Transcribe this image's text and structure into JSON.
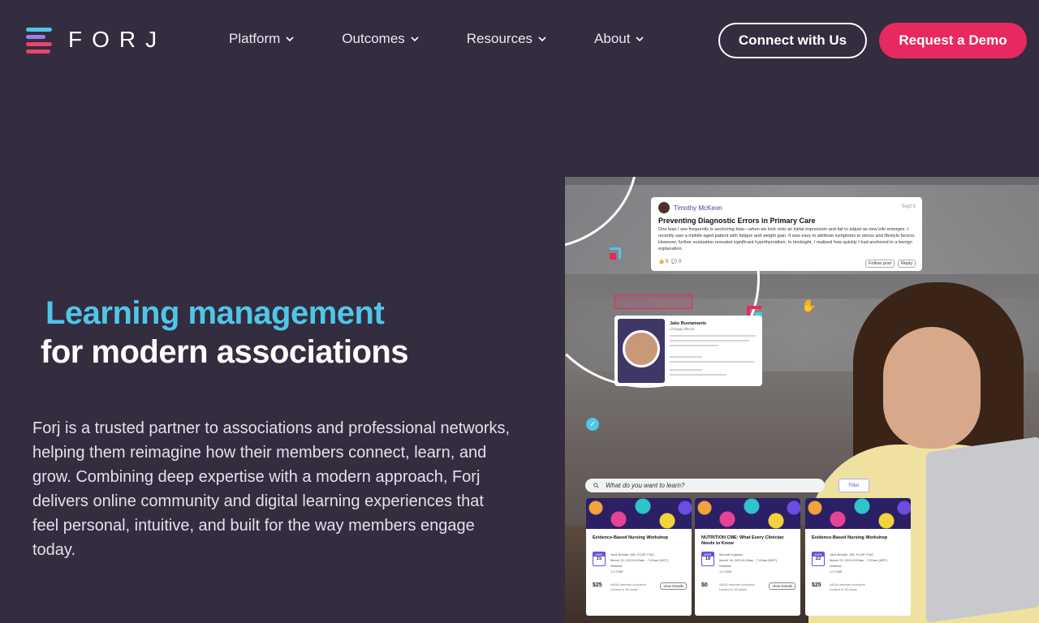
{
  "nav": {
    "logo_text": "FORJ",
    "menu": [
      {
        "label": "Platform"
      },
      {
        "label": "Outcomes"
      },
      {
        "label": "Resources"
      },
      {
        "label": "About"
      }
    ],
    "connect_label": "Connect with Us",
    "demo_label": "Request a Demo"
  },
  "hero": {
    "title_line1": "Learning management",
    "title_line2": "for modern associations",
    "description": "Forj is a trusted partner to associations and professional networks, helping them reimagine how their members connect, learn, and grow. Combining deep expertise with a modern approach, Forj delivers online community and digital learning experiences that feel personal, intuitive, and built for the way members engage today."
  },
  "post": {
    "author": "Timothy McKeon",
    "date": "Sept 5",
    "title": "Preventing Diagnostic Errors in Primary Care",
    "body": "One bias I see frequently is anchoring bias—when we lock onto an initial impression and fail to adjust as new info emerges. I recently saw a middle-aged patient with fatigue and weight gain. It was easy to attribute symptoms to stress and lifestyle factors. However, further evaluation revealed significant hypothyroidism. In hindsight, I realized how quickly I had anchored to a benign explanation.",
    "likes": "5",
    "comments": "0",
    "follow_label": "Follow post",
    "reply_label": "Reply"
  },
  "profile": {
    "name": "Jake Bustamante",
    "location": "Chicago Illinois"
  },
  "search": {
    "placeholder": "What do you want to learn?",
    "filter_label": "Filter"
  },
  "courses": [
    {
      "title": "Evidence-Based Nursing Workshop",
      "month": "MAR",
      "day": "15",
      "presenter": "Jane Brindle, MD, FCAP, FIAC",
      "date": "March 15, 2024 6:00am - 7:00am (MST)",
      "format": "Webinar",
      "credits": "1.0 CME",
      "price": "$25",
      "note": "AASA member exclusive\nLimited to 50 seats",
      "btn": "View Details"
    },
    {
      "title": "NUTRITION CME: What Every Clinician Needs to Know",
      "month": "MAR",
      "day": "18",
      "presenter": "Michael Kapasin",
      "date": "March 18, 2024 6:00am - 7:00am (MST)",
      "format": "Webinar",
      "credits": "1.0 CME",
      "price": "$0",
      "note": "AASA member exclusive\nLimited to 50 seats",
      "btn": "View Details"
    },
    {
      "title": "Evidence-Based Nursing Workshop",
      "month": "MAR",
      "day": "22",
      "presenter": "Jane Brindle, MD, FCAP, FIAC",
      "date": "March 22, 2024 6:00am - 7:00am (MST)",
      "format": "Webinar",
      "credits": "1.0 CME",
      "price": "$25",
      "note": "AASA member exclusive\nLimited to 50 seats",
      "btn": ""
    }
  ],
  "colors": {
    "background": "#342c3f",
    "accent_cyan": "#4fc6e8",
    "accent_pink": "#e8295f"
  }
}
